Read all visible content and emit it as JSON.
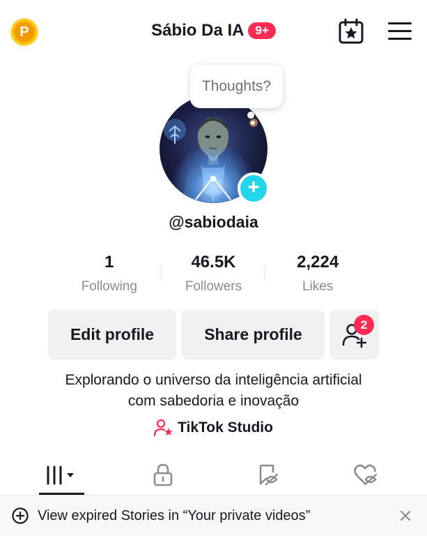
{
  "header": {
    "coin_letter": "P",
    "title": "Sábio Da IA",
    "notification_badge": "9+"
  },
  "profile": {
    "thought_bubble": "Thoughts?",
    "username": "@sabiodaia",
    "stats": [
      {
        "value": "1",
        "label": "Following"
      },
      {
        "value": "46.5K",
        "label": "Followers"
      },
      {
        "value": "2,224",
        "label": "Likes"
      }
    ],
    "buttons": {
      "edit": "Edit profile",
      "share": "Share profile",
      "friends_badge": "2"
    },
    "bio_line1": "Explorando o universo da inteligência artificial",
    "bio_line2": "com sabedoria e inovação",
    "studio_link": "TikTok Studio"
  },
  "tabs": [
    {
      "name": "videos-grid",
      "active": true
    },
    {
      "name": "private"
    },
    {
      "name": "reposts"
    },
    {
      "name": "liked"
    }
  ],
  "banner": {
    "text": "View expired Stories in “Your private videos”"
  },
  "colors": {
    "accent": "#fe2c55",
    "cyan": "#20d5ec",
    "coin": "#f7b800"
  }
}
